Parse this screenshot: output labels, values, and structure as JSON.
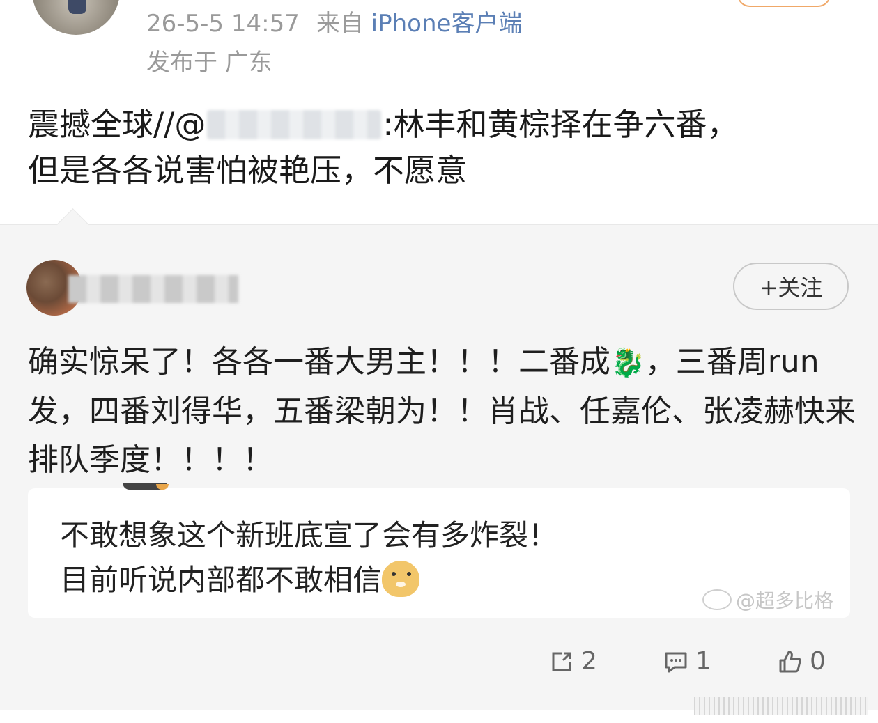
{
  "post": {
    "date": "26-5-5 14:57",
    "from_prefix": "来自",
    "client": "iPhone客户端",
    "location": "发布于 广东",
    "text_before": "震撼全球//@",
    "text_after": ":林丰和黄棕择在争六番，",
    "text_line2": "但是各各说害怕被艳压，不愿意"
  },
  "repost": {
    "follow_label": "+关注",
    "text_part1": "确实惊呆了！各各一番大男主！！！二番成",
    "text_part2": "，三番周run发，四番刘得华，五番梁朝为！！肖战、任嘉伦、张凌赫快来排队季度！！！！",
    "quote_line1": "不敢想象这个新班底宣了会有多炸裂！",
    "quote_line2": "目前听说内部都不敢相信",
    "watermark": "@超多比格"
  },
  "actions": {
    "repost_count": "2",
    "comment_count": "1",
    "like_count": "0"
  },
  "icons": {
    "dragon": "dragon-emoji",
    "doge": "doge-emoji",
    "repost": "repost-icon",
    "comment": "comment-icon",
    "like": "thumbs-up-icon"
  }
}
